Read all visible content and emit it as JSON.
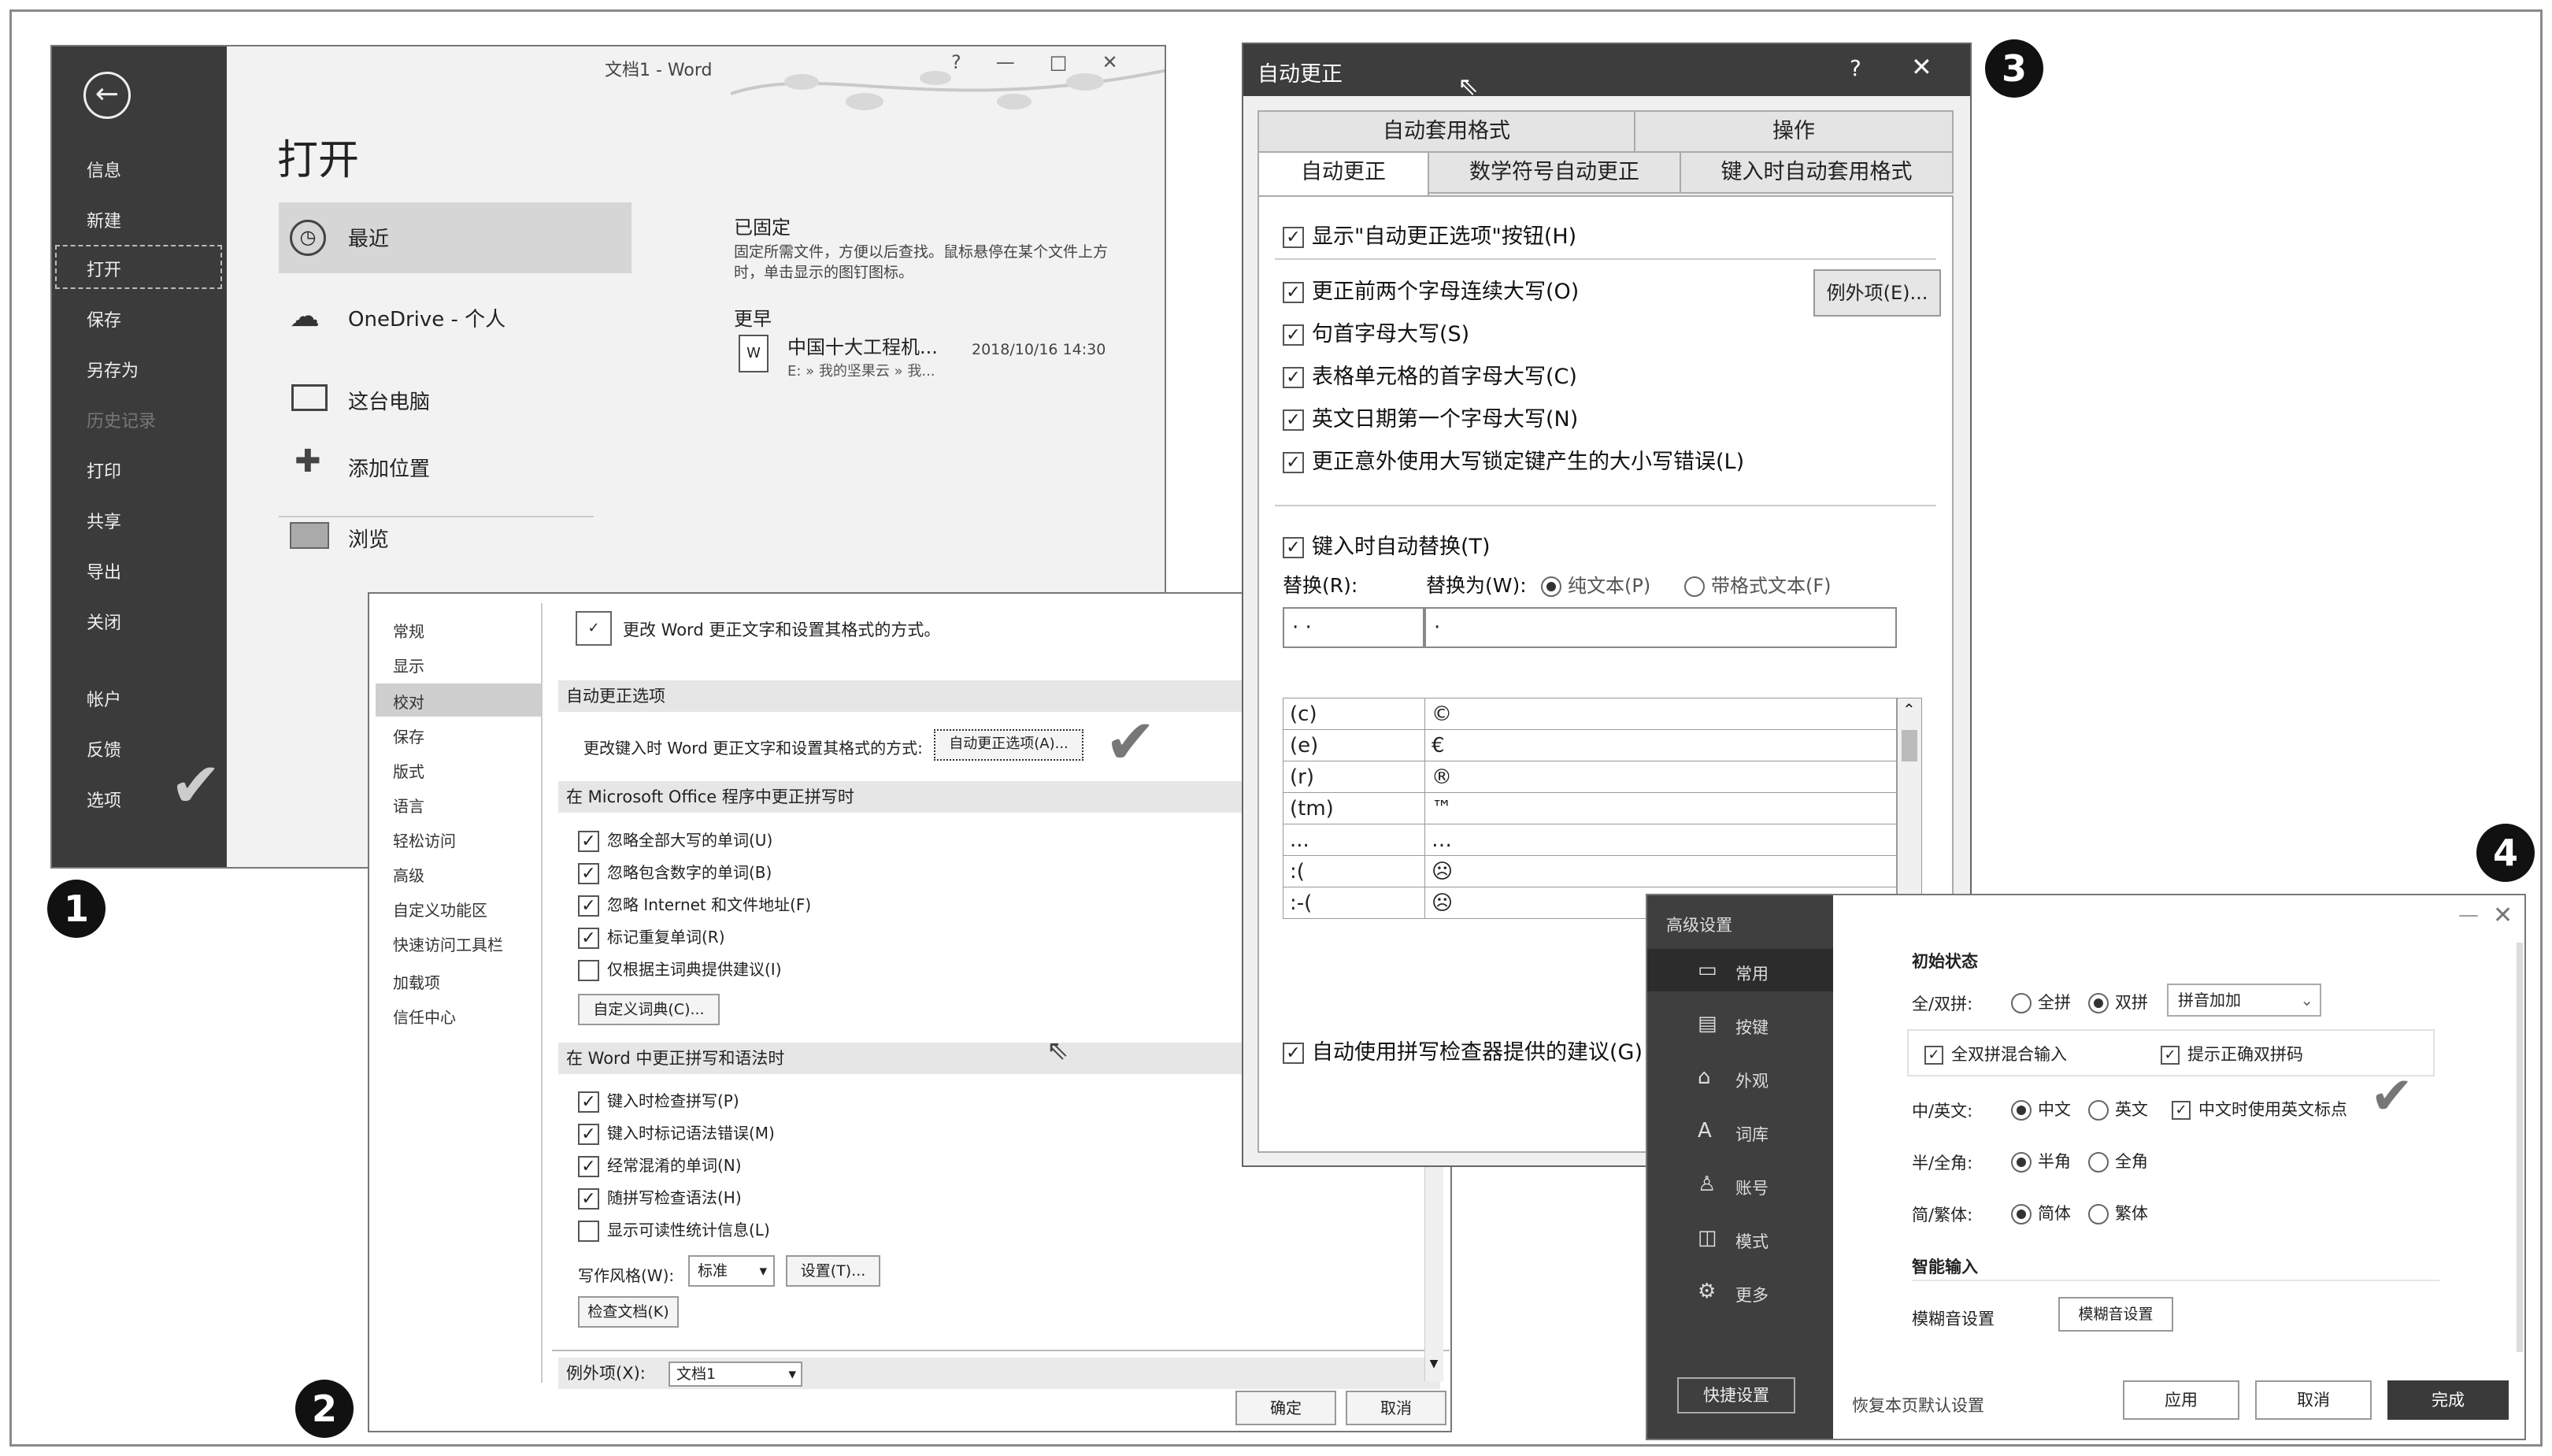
{
  "markers": [
    "1",
    "2",
    "3",
    "4"
  ],
  "win1": {
    "title": "文档1 - Word",
    "controls": [
      "?",
      "—",
      "□",
      "✕"
    ],
    "side_items": [
      "信息",
      "新建",
      "打开",
      "保存",
      "另存为",
      "历史记录",
      "打印",
      "共享",
      "导出",
      "关闭",
      "帐户",
      "反馈",
      "选项"
    ],
    "heading": "打开",
    "locations": [
      "最近",
      "OneDrive - 个人",
      "这台电脑",
      "添加位置",
      "浏览"
    ],
    "pinned_title": "已固定",
    "pinned_desc": "固定所需文件，方便以后查找。鼠标悬停在某个文件上方时，单击显示的图钉图标。",
    "earlier_title": "更早",
    "recent_file": {
      "name": "中国十大工程机...",
      "path": "E: » 我的坚果云 » 我...",
      "date": "2018/10/16 14:30"
    }
  },
  "win2": {
    "nav": [
      "常规",
      "显示",
      "校对",
      "保存",
      "版式",
      "语言",
      "轻松访问",
      "高级",
      "自定义功能区",
      "快速访问工具栏",
      "加载项",
      "信任中心"
    ],
    "intro": "更改 Word 更正文字和设置其格式的方式。",
    "sec1": "自动更正选项",
    "sec1_row": "更改键入时 Word 更正文字和设置其格式的方式:",
    "autocorrect_btn": "自动更正选项(A)...",
    "sec2": "在 Microsoft Office 程序中更正拼写时",
    "sec2_items": [
      {
        "label": "忽略全部大写的单词(U)",
        "checked": true
      },
      {
        "label": "忽略包含数字的单词(B)",
        "checked": true
      },
      {
        "label": "忽略 Internet 和文件地址(F)",
        "checked": true
      },
      {
        "label": "标记重复单词(R)",
        "checked": true
      },
      {
        "label": "仅根据主词典提供建议(I)",
        "checked": false
      }
    ],
    "dict_btn": "自定义词典(C)...",
    "sec3": "在 Word 中更正拼写和语法时",
    "sec3_items": [
      {
        "label": "键入时检查拼写(P)",
        "checked": true
      },
      {
        "label": "键入时标记语法错误(M)",
        "checked": true
      },
      {
        "label": "经常混淆的单词(N)",
        "checked": true
      },
      {
        "label": "随拼写检查语法(H)",
        "checked": true
      },
      {
        "label": "显示可读性统计信息(L)",
        "checked": false
      }
    ],
    "style_label": "写作风格(W):",
    "style_value": "标准",
    "settings_btn": "设置(T)...",
    "recheck_btn": "检查文档(K)",
    "except_label": "例外项(X):",
    "except_value": "文档1",
    "ok": "确定",
    "cancel": "取消"
  },
  "win3": {
    "title": "自动更正",
    "controls": [
      "?",
      "✕"
    ],
    "tabs_top": [
      "自动套用格式",
      "操作"
    ],
    "tabs_bottom": [
      "自动更正",
      "数学符号自动更正",
      "键入时自动套用格式"
    ],
    "show_btn_opt": "显示\"自动更正选项\"按钮(H)",
    "options": [
      "更正前两个字母连续大写(O)",
      "句首字母大写(S)",
      "表格单元格的首字母大写(C)",
      "英文日期第一个字母大写(N)",
      "更正意外使用大写锁定键产生的大小写错误(L)"
    ],
    "exceptions_btn": "例外项(E)...",
    "replace_opt": "键入时自动替换(T)",
    "replace_label": "替换(R):",
    "with_label": "替换为(W):",
    "plain_text": "纯文本(P)",
    "formatted_text": "带格式文本(F)",
    "replace_value": "· ·",
    "with_value": "·",
    "table": [
      [
        "(c)",
        "©"
      ],
      [
        "(e)",
        "€"
      ],
      [
        "(r)",
        "®"
      ],
      [
        "(tm)",
        "™"
      ],
      [
        "...",
        "…"
      ],
      [
        ":(",
        "☹"
      ],
      [
        ":-(",
        "☹"
      ]
    ],
    "spell_opt": "自动使用拼写检查器提供的建议(G)"
  },
  "win4": {
    "title": "高级设置",
    "side": [
      "常用",
      "按键",
      "外观",
      "词库",
      "账号",
      "模式",
      "更多"
    ],
    "side_icons": [
      "▭",
      "▤",
      "⌂",
      "A",
      "♙",
      "◫",
      "⚙"
    ],
    "quick_btn": "快捷设置",
    "restore": "恢复本页默认设置",
    "init_title": "初始状态",
    "pinyin_label": "全/双拼:",
    "full_pinyin": "全拼",
    "double_pinyin": "双拼",
    "scheme": "拼音加加",
    "mix_input": "全双拼混合输入",
    "hint_code": "提示正确双拼码",
    "cn_en_label": "中/英文:",
    "cn": "中文",
    "en": "英文",
    "cn_punct": "中文时使用英文标点",
    "width_label": "半/全角:",
    "half": "半角",
    "full": "全角",
    "script_label": "简/繁体:",
    "simp": "简体",
    "trad": "繁体",
    "smart_title": "智能输入",
    "fuzzy_label": "模糊音设置",
    "fuzzy_btn": "模糊音设置",
    "apply": "应用",
    "cancel": "取消",
    "done": "完成"
  }
}
